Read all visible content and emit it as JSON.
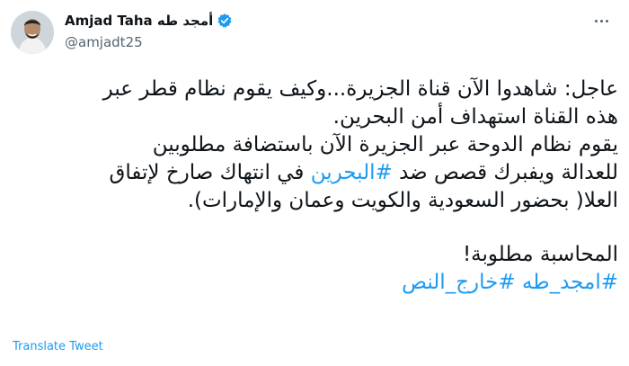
{
  "author": {
    "display_name": "Amjad Taha أمجد طه",
    "handle": "@amjadt25",
    "avatar_icon": "avatar-photo",
    "verified_icon": "verified-badge-icon",
    "verified_color": "#1d9bf0"
  },
  "tweet": {
    "lines": [
      "عاجل: شاهدوا الآن قناة الجزيرة...وكيف يقوم نظام قطر عبر",
      "هذه القناة استهداف أمن البحرين.",
      "يقوم نظام الدوحة عبر الجزيرة الآن باستضافة مطلوبين",
      "للعدالة ويفبرك قصص ضد",
      "في انتهاك صارخ لإتفاق",
      "العلا( بحضور السعودية والكويت وعمان والإمارات).",
      "المحاسبة مطلوبة!"
    ],
    "hashtags": [
      "#البحرين",
      "#امجد_طه",
      "#خارج_النص"
    ],
    "hashtag_color": "#1d9bf0"
  },
  "actions": {
    "translate_label": "Translate Tweet",
    "more_icon": "more-options-icon"
  }
}
